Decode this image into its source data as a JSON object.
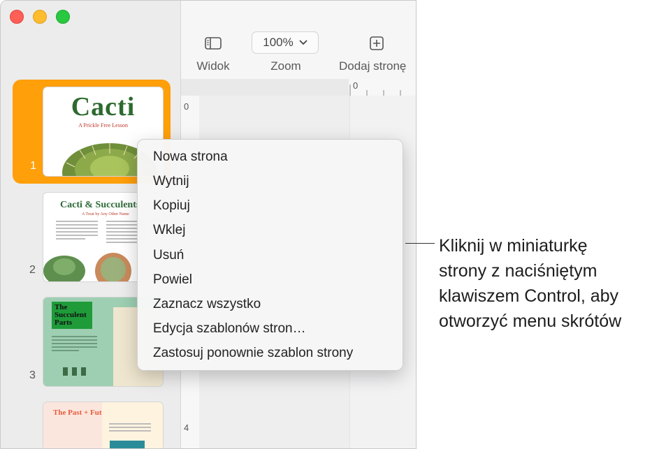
{
  "toolbar": {
    "view_label": "Widok",
    "zoom_value": "100%",
    "zoom_label": "Zoom",
    "add_page_label": "Dodaj stronę"
  },
  "rulers": {
    "top_zero": "0",
    "left_zero": "0",
    "left_four": "4"
  },
  "thumbnails": [
    {
      "number": "1",
      "title": "Cacti",
      "subtitle": "A Prickle Free Lesson"
    },
    {
      "number": "2",
      "title": "Cacti & Succulents",
      "subtitle": "A Treat by Any Other Name"
    },
    {
      "number": "3",
      "title": "The Succulent Parts"
    },
    {
      "number": "",
      "title": "The Past + Future of Succulents"
    }
  ],
  "context_menu": {
    "items": [
      "Nowa strona",
      "Wytnij",
      "Kopiuj",
      "Wklej",
      "Usuń",
      "Powiel",
      "Zaznacz wszystko",
      "Edycja szablonów stron…",
      "Zastosuj ponownie szablon strony"
    ]
  },
  "callout": {
    "lines": [
      "Kliknij w miniaturkę",
      "strony z naciśniętym",
      "klawiszem Control, aby",
      "otworzyć menu skrótów"
    ]
  },
  "colors": {
    "selection": "#ff9f0a",
    "traffic_red": "#fe5f57",
    "traffic_yellow": "#febc2e",
    "traffic_green": "#28c840"
  }
}
